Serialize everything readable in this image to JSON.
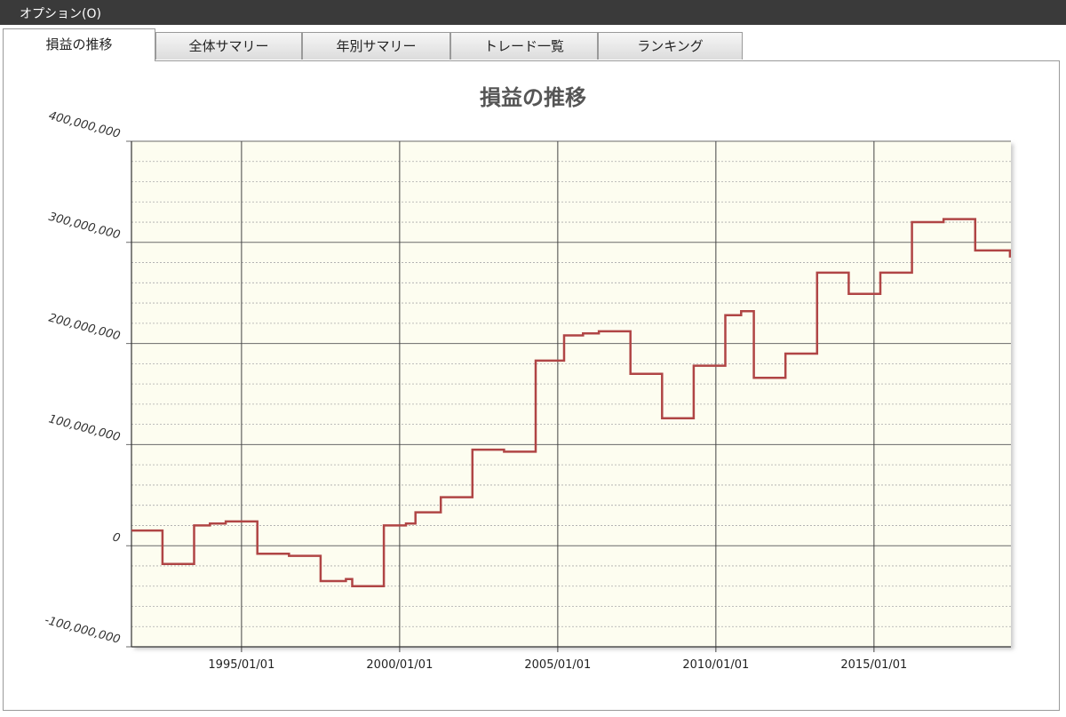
{
  "menu": {
    "options_label": "オプション(O)"
  },
  "tabs": [
    {
      "label": "損益の推移",
      "active": true
    },
    {
      "label": "全体サマリー",
      "active": false
    },
    {
      "label": "年別サマリー",
      "active": false
    },
    {
      "label": "トレード一覧",
      "active": false
    },
    {
      "label": "ランキング",
      "active": false
    }
  ],
  "colors": {
    "line": "#b04545",
    "plot_bg": "#fdfdf0"
  },
  "chart_data": {
    "type": "line",
    "step": true,
    "title": "損益の推移",
    "xlabel": "",
    "ylabel": "",
    "ylim": [
      -100000000,
      400000000
    ],
    "xlim": [
      1991.52,
      2019.33
    ],
    "grid": true,
    "y_ticks": [
      -100000000,
      0,
      100000000,
      200000000,
      300000000,
      400000000
    ],
    "y_tick_labels": [
      "-100,000,000",
      "0",
      "100,000,000",
      "200,000,000",
      "300,000,000",
      "400,000,000"
    ],
    "x_ticks": [
      1995,
      2000,
      2005,
      2010,
      2015
    ],
    "x_tick_labels": [
      "1995/01/01",
      "2000/01/01",
      "2005/01/01",
      "2010/01/01",
      "2015/01/01"
    ],
    "series": [
      {
        "x": [
          1991.5,
          1992.5,
          1993.5,
          1994.0,
          1994.5,
          1995.5,
          1996.5,
          1997.5,
          1998.3,
          1998.5,
          1999.5,
          2000.2,
          2000.5,
          2001.3,
          2002.3,
          2003.3,
          2004.3,
          2005.2,
          2005.8,
          2006.3,
          2007.3,
          2008.3,
          2009.3,
          2010.3,
          2010.8,
          2011.2,
          2012.2,
          2013.2,
          2014.2,
          2015.2,
          2016.2,
          2017.2,
          2018.2,
          2019.3
        ],
        "y": [
          15000000,
          -18000000,
          20000000,
          22000000,
          24000000,
          -8000000,
          -10000000,
          -35000000,
          -33000000,
          -40000000,
          20000000,
          22000000,
          33000000,
          48000000,
          95000000,
          93000000,
          183000000,
          208000000,
          210000000,
          212000000,
          170000000,
          126000000,
          178000000,
          228000000,
          232000000,
          166000000,
          190000000,
          270000000,
          249000000,
          270000000,
          320000000,
          323000000,
          292000000,
          285000000
        ]
      }
    ]
  }
}
